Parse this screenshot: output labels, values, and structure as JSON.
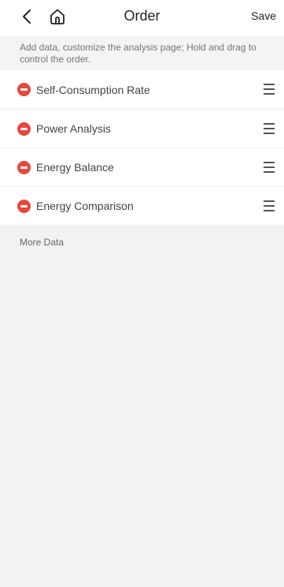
{
  "header": {
    "title": "Order",
    "save_label": "Save",
    "back_icon": "chevron-left-icon",
    "home_icon": "home-icon"
  },
  "hint": "Add data, customize the analysis page; Hold and drag to control the order.",
  "items": [
    {
      "label": "Self-Consumption Rate"
    },
    {
      "label": "Power Analysis"
    },
    {
      "label": "Energy Balance"
    },
    {
      "label": "Energy Comparison"
    }
  ],
  "more_data_label": "More Data",
  "colors": {
    "remove": "#e8473c",
    "background": "#f2f2f2",
    "surface": "#ffffff"
  }
}
